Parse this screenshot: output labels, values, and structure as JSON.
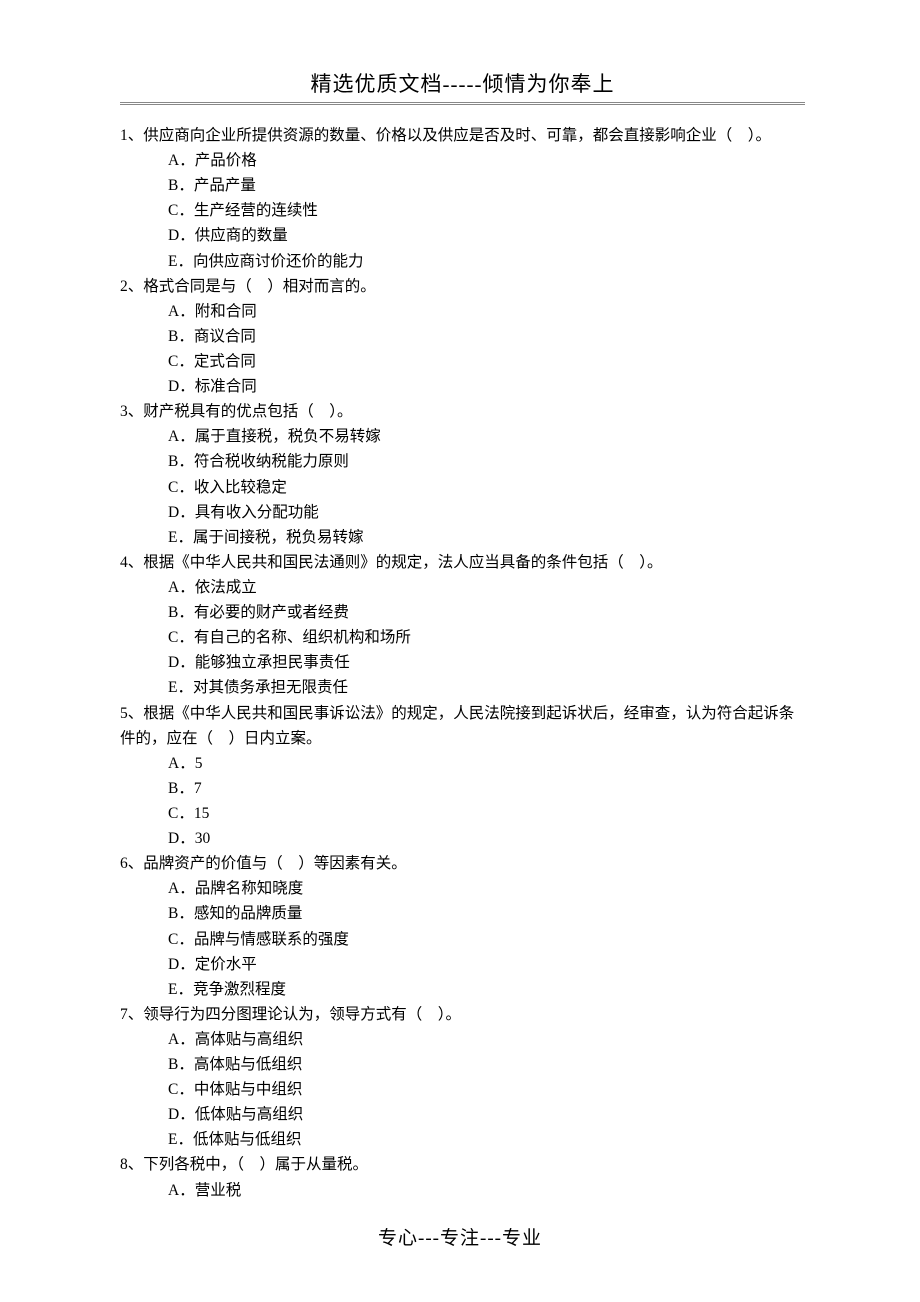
{
  "header": "精选优质文档-----倾情为你奉上",
  "footer": "专心---专注---专业",
  "questions": [
    {
      "text": "1、供应商向企业所提供资源的数量、价格以及供应是否及时、可靠，都会直接影响企业（　）。",
      "options": [
        "A．产品价格",
        "B．产品产量",
        "C．生产经营的连续性",
        "D．供应商的数量",
        "E．向供应商讨价还价的能力"
      ]
    },
    {
      "text": "2、格式合同是与（　）相对而言的。",
      "options": [
        "A．附和合同",
        "B．商议合同",
        "C．定式合同",
        "D．标准合同"
      ]
    },
    {
      "text": "3、财产税具有的优点包括（　）。",
      "options": [
        "A．属于直接税，税负不易转嫁",
        "B．符合税收纳税能力原则",
        "C．收入比较稳定",
        "D．具有收入分配功能",
        "E．属于间接税，税负易转嫁"
      ]
    },
    {
      "text": "4、根据《中华人民共和国民法通则》的规定，法人应当具备的条件包括（　）。",
      "options": [
        "A．依法成立",
        "B．有必要的财产或者经费",
        "C．有自己的名称、组织机构和场所",
        "D．能够独立承担民事责任",
        "E．对其债务承担无限责任"
      ]
    },
    {
      "text": "5、根据《中华人民共和国民事诉讼法》的规定，人民法院接到起诉状后，经审查，认为符合起诉条件的，应在（　）日内立案。",
      "options": [
        "A．5",
        "B．7",
        "C．15",
        "D．30"
      ]
    },
    {
      "text": "6、品牌资产的价值与（　）等因素有关。",
      "options": [
        "A．品牌名称知晓度",
        "B．感知的品牌质量",
        "C．品牌与情感联系的强度",
        "D．定价水平",
        "E．竞争激烈程度"
      ]
    },
    {
      "text": "7、领导行为四分图理论认为，领导方式有（　）。",
      "options": [
        "A．高体贴与高组织",
        "B．高体贴与低组织",
        "C．中体贴与中组织",
        "D．低体贴与高组织",
        "E．低体贴与低组织"
      ]
    },
    {
      "text": "8、下列各税中，（　）属于从量税。",
      "options": [
        "A．营业税"
      ]
    }
  ]
}
